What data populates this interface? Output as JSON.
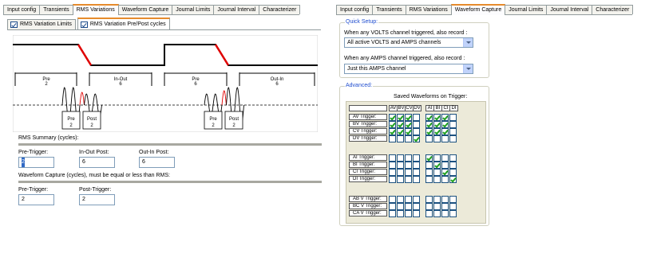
{
  "left": {
    "tabs": [
      "Input config",
      "Transients",
      "RMS Variations",
      "Waveform Capture",
      "Journal Limits",
      "Journal Interval",
      "Characterizer"
    ],
    "active_tab": "RMS Variations",
    "subtabs": [
      "RMS Variation Limits",
      "RMS Variation Pre/Post cycles"
    ],
    "active_subtab": "RMS Variation Pre/Post cycles",
    "diagram": {
      "segments": [
        {
          "label": "Pre",
          "value": "2"
        },
        {
          "label": "In-Out",
          "value": "6"
        },
        {
          "label": "Pre",
          "value": "6"
        },
        {
          "label": "Out-In",
          "value": "6"
        }
      ],
      "wave_labels": [
        {
          "label": "Pre",
          "value": "2"
        },
        {
          "label": "Post",
          "value": "2"
        },
        {
          "label": "Pre",
          "value": "2"
        },
        {
          "label": "Post",
          "value": "2"
        }
      ]
    },
    "rms_summary": {
      "title": "RMS Summary (cycles):",
      "pre_trigger_label": "Pre-Trigger:",
      "pre_trigger_value": "2",
      "in_out_label": "In-Out Post:",
      "in_out_value": "6",
      "out_in_label": "Out-In Post:",
      "out_in_value": "6"
    },
    "waveform_capture": {
      "title": "Waveform Capture (cycles), must be equal or less than RMS:",
      "pre_trigger_label": "Pre-Trigger:",
      "pre_trigger_value": "2",
      "post_trigger_label": "Post-Trigger:",
      "post_trigger_value": "2"
    }
  },
  "right": {
    "tabs": [
      "Input config",
      "Transients",
      "RMS Variations",
      "Waveform Capture",
      "Journal Limits",
      "Journal Interval",
      "Characterizer"
    ],
    "active_tab": "Waveform Capture",
    "quick_setup": {
      "title": "Quick Setup:",
      "volts_label": "When any VOLTS channel triggered, also record :",
      "volts_value": "All active VOLTS and AMPS channels",
      "amps_label": "When any AMPS channel triggered, also record :",
      "amps_value": "Just this AMPS channel"
    },
    "advanced": {
      "title": "Advanced:",
      "matrix_title": "Saved Waveforms on Trigger:",
      "columns": [
        "AV",
        "BV",
        "CV",
        "DV",
        "AI",
        "BI",
        "CI",
        "DI"
      ],
      "rows": [
        {
          "label": "AV Trigger:",
          "checks": [
            1,
            1,
            1,
            0,
            1,
            1,
            1,
            0
          ]
        },
        {
          "label": "BV Trigger:",
          "checks": [
            1,
            1,
            1,
            0,
            1,
            1,
            1,
            0
          ]
        },
        {
          "label": "CV Trigger:",
          "checks": [
            1,
            1,
            1,
            0,
            1,
            1,
            1,
            0
          ]
        },
        {
          "label": "DV Trigger:",
          "checks": [
            0,
            0,
            0,
            1,
            0,
            0,
            0,
            0
          ]
        },
        {
          "label": "AI Trigger:",
          "checks": [
            0,
            0,
            0,
            0,
            1,
            0,
            0,
            0
          ]
        },
        {
          "label": "BI Trigger:",
          "checks": [
            0,
            0,
            0,
            0,
            0,
            1,
            0,
            0
          ]
        },
        {
          "label": "CI Trigger:",
          "checks": [
            0,
            0,
            0,
            0,
            0,
            0,
            1,
            0
          ]
        },
        {
          "label": "DI Trigger:",
          "checks": [
            0,
            0,
            0,
            0,
            0,
            0,
            0,
            1
          ]
        },
        {
          "label": "AB V Trigger:",
          "checks": [
            0,
            0,
            0,
            0,
            0,
            0,
            0,
            0
          ]
        },
        {
          "label": "BC V Trigger:",
          "checks": [
            0,
            0,
            0,
            0,
            0,
            0,
            0,
            0
          ]
        },
        {
          "label": "CA V Trigger:",
          "checks": [
            0,
            0,
            0,
            0,
            0,
            0,
            0,
            0
          ]
        }
      ]
    }
  },
  "colors": {
    "active_tab_accent": "#e68b2c",
    "group_title": "#1f4dcf",
    "diagram_red": "#e00000",
    "checkmark": "#21a121"
  }
}
